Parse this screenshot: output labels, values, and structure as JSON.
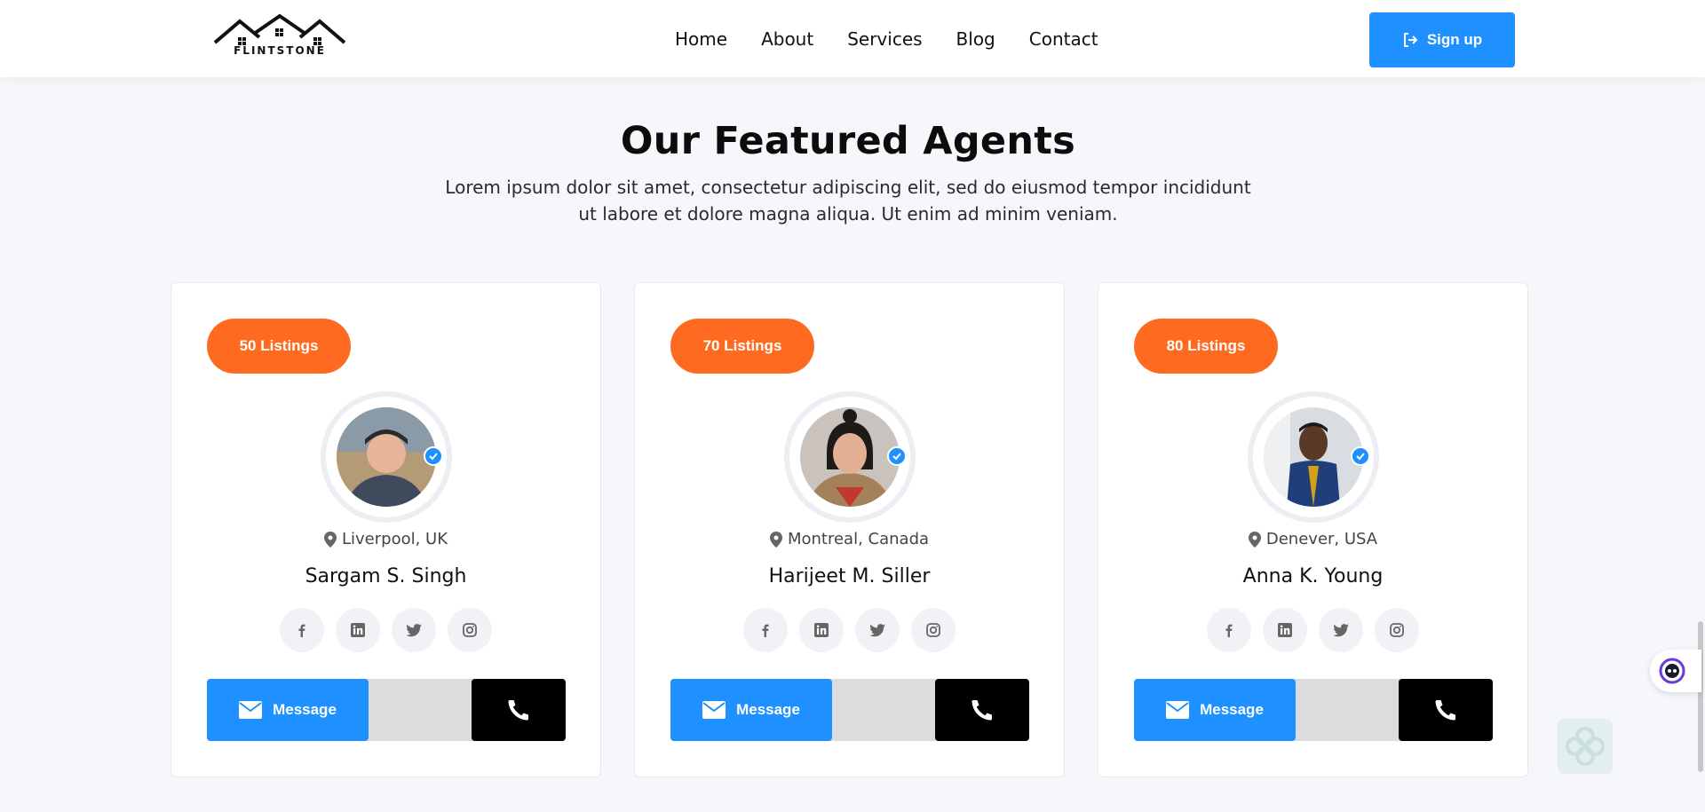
{
  "brand": {
    "logo_text": "FLINTSTONE"
  },
  "nav": {
    "links": [
      "Home",
      "About",
      "Services",
      "Blog",
      "Contact"
    ],
    "signup_label": "Sign up"
  },
  "section": {
    "title": "Our Featured Agents",
    "description_line1": "Lorem ipsum dolor sit amet, consectetur adipiscing elit, sed do eiusmod tempor incididunt",
    "description_line2": "ut labore et dolore magna aliqua. Ut enim ad minim veniam."
  },
  "agents": [
    {
      "listings": "50 Listings",
      "location": "Liverpool, UK",
      "name": "Sargam S. Singh",
      "message_label": "Message"
    },
    {
      "listings": "70 Listings",
      "location": "Montreal, Canada",
      "name": "Harijeet M. Siller",
      "message_label": "Message"
    },
    {
      "listings": "80 Listings",
      "location": "Denever, USA",
      "name": "Anna K. Young",
      "message_label": "Message"
    }
  ],
  "colors": {
    "primary": "#1e90ff",
    "accent": "#ff6a21",
    "dark": "#000000",
    "page_bg": "#f6f7fb"
  },
  "icons": [
    "sign-in-icon",
    "map-pin-icon",
    "verified-check-icon",
    "facebook-icon",
    "linkedin-icon",
    "twitter-icon",
    "instagram-icon",
    "envelope-icon",
    "phone-icon",
    "chat-bot-icon"
  ]
}
